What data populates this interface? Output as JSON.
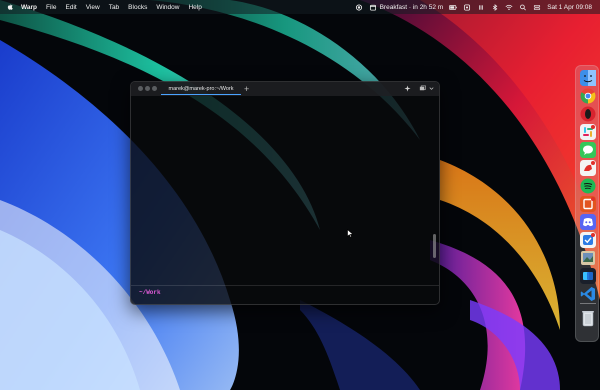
{
  "menubar": {
    "app_name": "Warp",
    "items": [
      "File",
      "Edit",
      "View",
      "Tab",
      "Blocks",
      "Window",
      "Help"
    ],
    "event_text": "Breakfast · in 2h 52 m",
    "datetime": "Sat 1 Apr  09:08",
    "status_icons": [
      "record-icon",
      "calendar-icon",
      "battery-icon",
      "menu-extra-icon",
      "pause-icon",
      "bluetooth-icon",
      "wifi-icon",
      "search-icon",
      "control-center-icon"
    ]
  },
  "terminal": {
    "tab_title": "marek@marek-pro:~/Work",
    "prompt_path": "~/Work",
    "scroll_position": 0.85
  },
  "dock": {
    "items": [
      {
        "name": "finder-icon",
        "color": "#3d8ee8"
      },
      {
        "name": "chrome-icon",
        "color": "#e8c23a"
      },
      {
        "name": "opera-icon",
        "color": "#d8242f"
      },
      {
        "name": "slack-icon",
        "color": "#e8e8ea"
      },
      {
        "name": "messages-icon",
        "color": "#34c759"
      },
      {
        "name": "bear-icon",
        "color": "#f2f2f2"
      },
      {
        "name": "spotify-icon",
        "color": "#1db954"
      },
      {
        "name": "office-icon",
        "color": "#e2541f"
      },
      {
        "name": "discord-icon",
        "color": "#5865f2"
      },
      {
        "name": "tasks-icon",
        "color": "#2c7be5"
      },
      {
        "name": "preview-icon",
        "color": "#c9b89a"
      },
      {
        "name": "warp-icon",
        "color": "#1a1f2a"
      },
      {
        "name": "vscode-icon",
        "color": "#2a8ae6"
      },
      {
        "name": "trash-icon",
        "color": "#d8dde2"
      }
    ]
  }
}
